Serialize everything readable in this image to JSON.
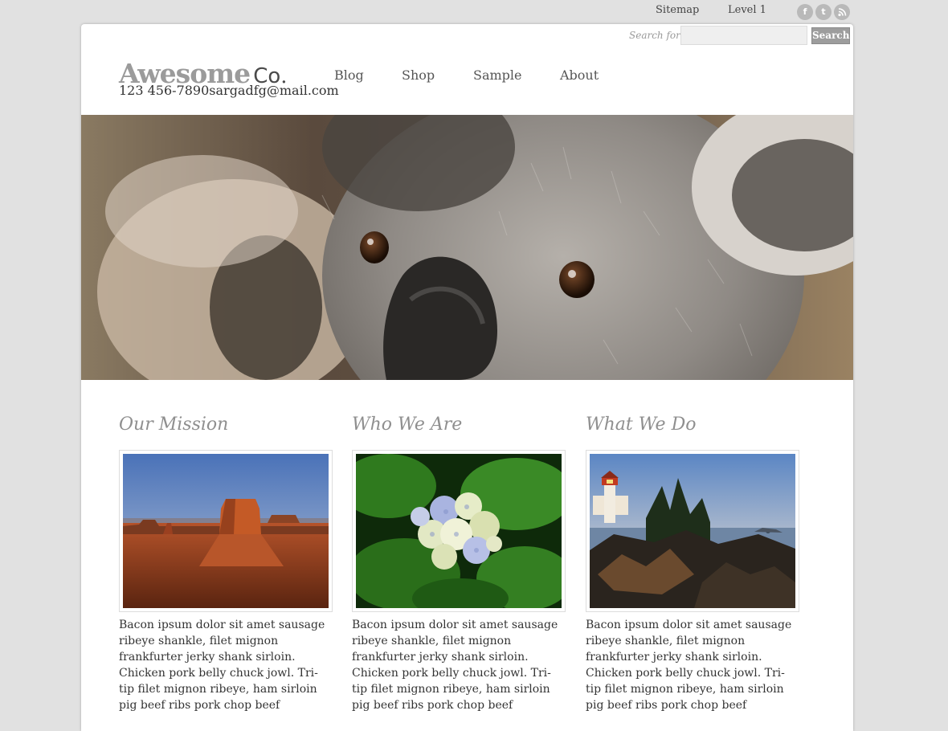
{
  "top_links": {
    "sitemap": "Sitemap",
    "level": "Level 1"
  },
  "social_icons": [
    "facebook-icon",
    "twitter-icon",
    "rss-icon"
  ],
  "search": {
    "label": "Search for:",
    "value": "",
    "button": "Search"
  },
  "brand": {
    "name_part1": "Awesome",
    "name_part2": "Co",
    "contact": "123 456-7890sargadfg@mail.com"
  },
  "nav": [
    "Blog",
    "Shop",
    "Sample",
    "About"
  ],
  "columns": [
    {
      "title": "Our Mission",
      "image": "desert-mesa-photo",
      "text": "Bacon ipsum dolor sit amet sausage ribeye shankle, filet mignon frankfurter jerky shank sirloin. Chicken pork belly chuck jowl. Tri-tip filet mignon ribeye, ham sirloin pig beef ribs pork chop beef"
    },
    {
      "title": "Who We Are",
      "image": "hydrangea-flower-photo",
      "text": "Bacon ipsum dolor sit amet sausage ribeye shankle, filet mignon frankfurter jerky shank sirloin. Chicken pork belly chuck jowl. Tri-tip filet mignon ribeye, ham sirloin pig beef ribs pork chop beef"
    },
    {
      "title": "What We Do",
      "image": "lighthouse-coast-photo",
      "text": "Bacon ipsum dolor sit amet sausage ribeye shankle, filet mignon frankfurter jerky shank sirloin. Chicken pork belly chuck jowl. Tri-tip filet mignon ribeye, ham sirloin pig beef ribs pork chop beef"
    }
  ],
  "colors": {
    "background": "#e1e1e1",
    "heading_gray": "#8f8f8f",
    "button_gray": "#9d9d9d"
  }
}
